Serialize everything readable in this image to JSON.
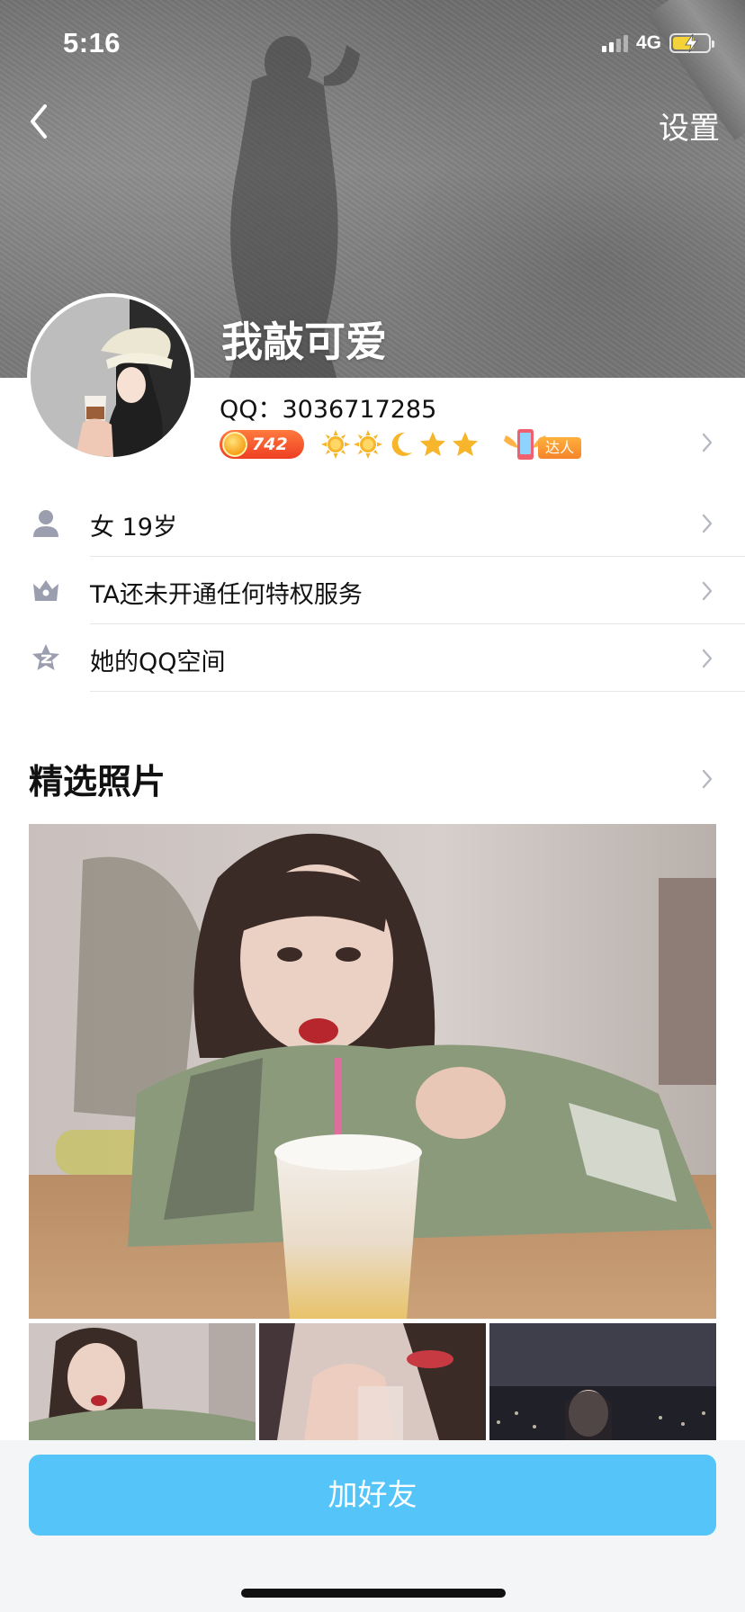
{
  "status_bar": {
    "time": "5:16",
    "network": "4G",
    "signal_bars_active": 2,
    "signal_bars_total": 4,
    "battery_level": 0.6,
    "battery_charging": true
  },
  "nav": {
    "back_icon": "chevron-left-icon",
    "settings_label": "设置"
  },
  "profile": {
    "nickname": "我敲可爱",
    "qq_line": "QQ：3036717285",
    "level_points": "742",
    "level_icons": [
      "sun-icon",
      "sun-icon",
      "moon-icon",
      "star-icon",
      "star-icon"
    ],
    "badge_label": "达人"
  },
  "info_items": [
    {
      "icon": "person-icon",
      "text": "女 19岁"
    },
    {
      "icon": "crown-icon",
      "text": "TA还未开通任何特权服务"
    },
    {
      "icon": "qzone-star-icon",
      "text": "她的QQ空间"
    }
  ],
  "photos_section": {
    "title": "精选照片"
  },
  "actions": {
    "add_friend_label": "加好友"
  },
  "colors": {
    "accent": "#55c5f9",
    "coin_badge": "#ee3f24",
    "badge_orange": "#f5832a",
    "chevron": "#b5b8c2",
    "icon_gray": "#9a9eae"
  }
}
